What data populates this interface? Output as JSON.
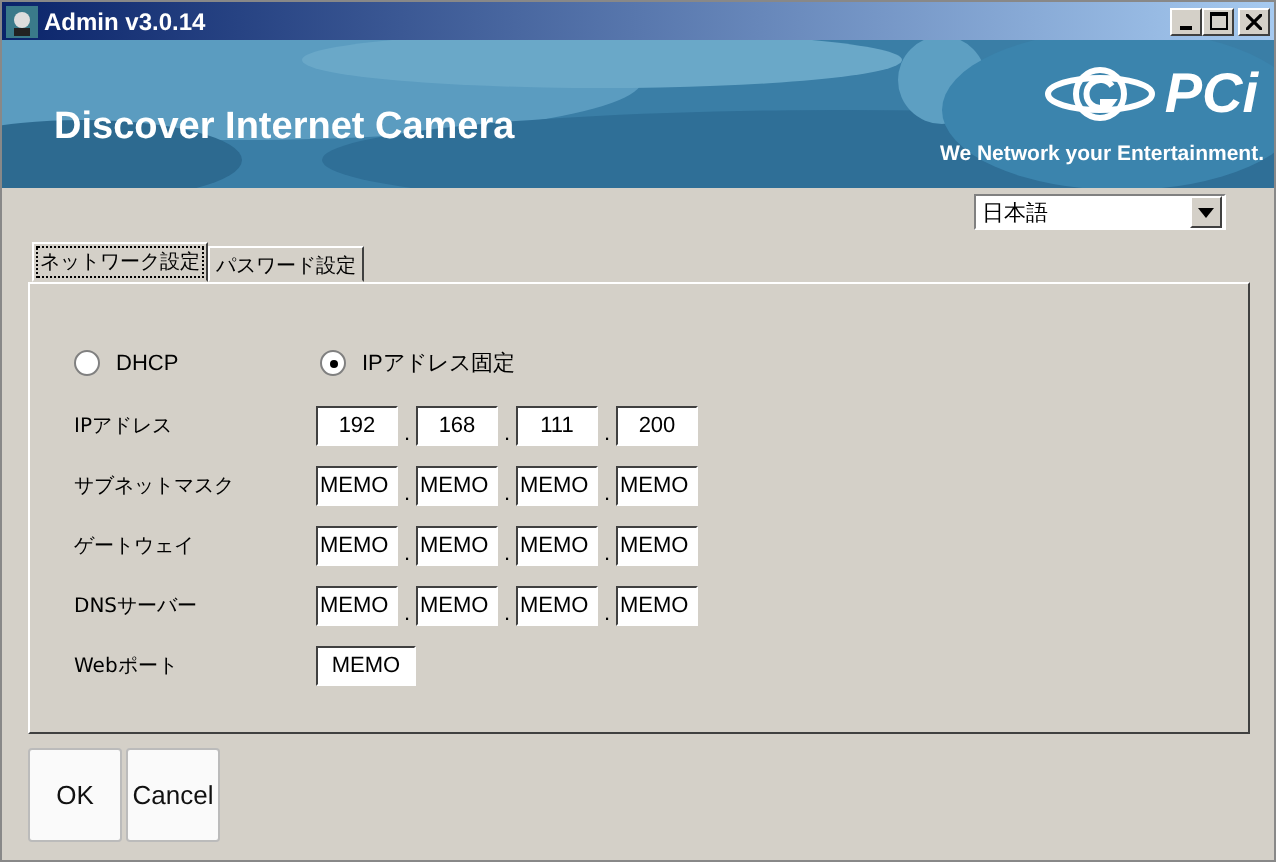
{
  "window": {
    "title": "Admin v3.0.14"
  },
  "banner": {
    "kind": "picture",
    "title": "Discover Internet Camera",
    "logo": "PCi",
    "tagline": "We Network your Entertainment."
  },
  "language": {
    "value": "日本語"
  },
  "tabs": [
    {
      "label": "ネットワーク設定",
      "selected": true
    },
    {
      "label": "パスワード設定",
      "selected": false
    }
  ],
  "mode": [
    {
      "label": "DHCP",
      "selected": false
    },
    {
      "label": "IPアドレス固定",
      "selected": true
    }
  ],
  "fields": [
    {
      "kind": "ip",
      "label": "IPアドレス",
      "separator": ".",
      "values": [
        "192",
        "168",
        "111",
        "200"
      ]
    },
    {
      "kind": "ip",
      "label": "サブネットマスク",
      "separator": ".",
      "values": [
        "MEMO",
        "MEMO",
        "MEMO",
        "MEMO"
      ]
    },
    {
      "kind": "ip",
      "label": "ゲートウェイ",
      "separator": ".",
      "values": [
        "MEMO",
        "MEMO",
        "MEMO",
        "MEMO"
      ]
    },
    {
      "kind": "ip",
      "label": "DNSサーバー",
      "separator": ".",
      "values": [
        "MEMO",
        "MEMO",
        "MEMO",
        "MEMO"
      ]
    },
    {
      "kind": "port",
      "label": "Webポート",
      "values": [
        "MEMO"
      ]
    }
  ],
  "buttons": [
    "OK",
    "Cancel"
  ]
}
